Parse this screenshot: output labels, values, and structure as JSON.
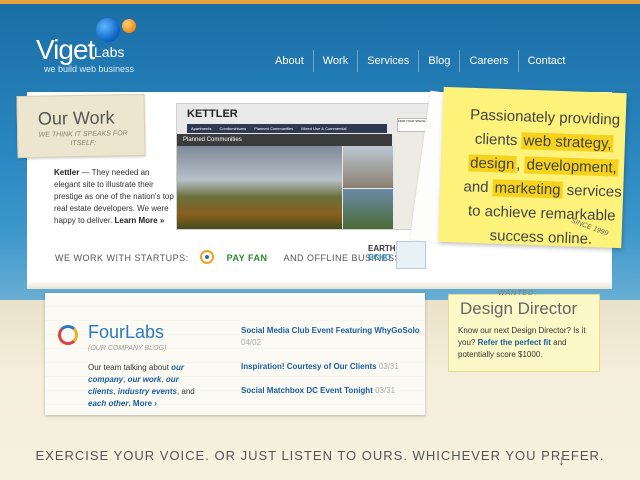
{
  "brand": {
    "name": "Viget",
    "suffix": "Labs",
    "tagline": "we build web business"
  },
  "nav": [
    {
      "label": "About"
    },
    {
      "label": "Work"
    },
    {
      "label": "Services"
    },
    {
      "label": "Blog"
    },
    {
      "label": "Careers"
    },
    {
      "label": "Contact"
    }
  ],
  "our_work": {
    "title": "Our Work",
    "subtitle": "WE THINK IT SPEAKS FOR ITSELF:",
    "project_name": "Kettler",
    "project_desc": " — They needed an elegant site to illustrate their prestige as one of the nation's top real estate developers. We were happy to deliver. ",
    "learn_more": "Learn More »"
  },
  "screenshot": {
    "brand": "KETTLER",
    "menu": [
      "Apartments",
      "Condominiums",
      "Planned Communities",
      "Mixed Use & Commercial"
    ],
    "label": "Planned Communities",
    "search_label": "FIND YOUR SPACE"
  },
  "sticky": {
    "line1": "Passionately providing",
    "line2a": "clients ",
    "hl1": "web strategy,",
    "hl2": "design",
    "sep": ", ",
    "hl3": "development,",
    "line4a": "and ",
    "hl4": "marketing",
    "line4b": " services",
    "line5": "to achieve remarkable",
    "line6": "success online.",
    "since": "SINCE 1999"
  },
  "startups": {
    "label": "WE WORK WITH STARTUPS:",
    "payfan": "PAY FAN",
    "offline": "AND OFFLINE BUSINESSES:",
    "earth1": "EARTH",
    "earth2": "ECHO"
  },
  "fourlabs": {
    "title": "FourLabs",
    "subtitle": "(OUR COMPANY BLOG)",
    "desc_pre": "Our team talking about ",
    "our": "our company",
    "comma1": ", ",
    "work": "our work",
    "comma2": ", ",
    "clients": "our clients",
    "comma3": ", ",
    "events": "industry events",
    "and": ", and ",
    "other": "each other",
    "more": ". More ›"
  },
  "posts": [
    {
      "title": "Social Media Club Event Featuring WhyGoSolo",
      "date": "04/02"
    },
    {
      "title": "Inspiration! Courtesy of Our Clients",
      "date": "03/31"
    },
    {
      "title": "Social Matchbox DC Event Tonight",
      "date": "03/31"
    }
  ],
  "design_director": {
    "wanted": "WANTED:",
    "title": "Design Director",
    "desc_pre": "Know our next Design Director? Is it you? ",
    "cta": "Refer the perfect fit",
    "desc_post": " and potentially score $1000."
  },
  "footer": {
    "text": "EXERCISE YOUR VOICE. OR JUST LISTEN TO OURS. WHICHEVER YOU PREFER."
  }
}
